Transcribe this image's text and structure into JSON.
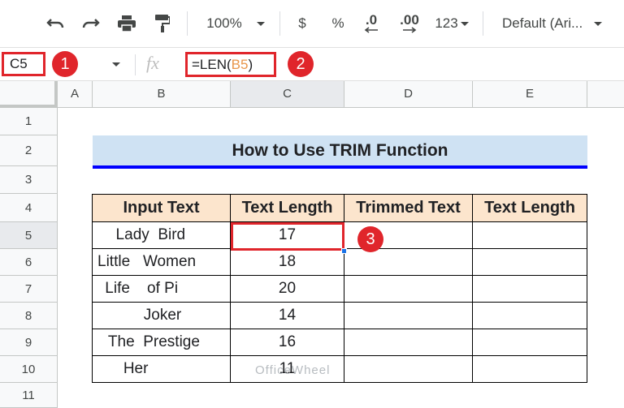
{
  "toolbar": {
    "zoom": "100%",
    "currency": "$",
    "percent": "%",
    "decrease_decimal": ".0",
    "increase_decimal": ".00",
    "number_format": "123",
    "font": "Default (Ari..."
  },
  "formula_bar": {
    "name_box": "C5",
    "fx": "fx",
    "formula_prefix": "=LEN(",
    "formula_ref": "B5",
    "formula_suffix": ")"
  },
  "callouts": [
    "1",
    "2",
    "3"
  ],
  "columns": [
    "A",
    "B",
    "C",
    "D",
    "E"
  ],
  "rows": [
    "1",
    "2",
    "3",
    "4",
    "5",
    "6",
    "7",
    "8",
    "9",
    "10",
    "11"
  ],
  "sheet": {
    "title": "How to Use TRIM Function",
    "headers": [
      "Input Text",
      "Text Length",
      "Trimmed Text",
      "Text Length"
    ],
    "data": [
      {
        "input": "  Lady  Bird",
        "length": "17"
      },
      {
        "input": "Little   Women",
        "length": "18"
      },
      {
        "input": " Life    of Pi",
        "length": "20"
      },
      {
        "input": "          Joker",
        "length": "14"
      },
      {
        "input": " The  Prestige",
        "length": "16"
      },
      {
        "input": "   Her",
        "length": "11"
      }
    ]
  },
  "watermark": "OfficeWheel",
  "colors": {
    "accent_red": "#e0252b",
    "header_fill": "#fce5cd",
    "title_fill": "#cfe2f3",
    "selection_blue": "#1a73e8"
  }
}
